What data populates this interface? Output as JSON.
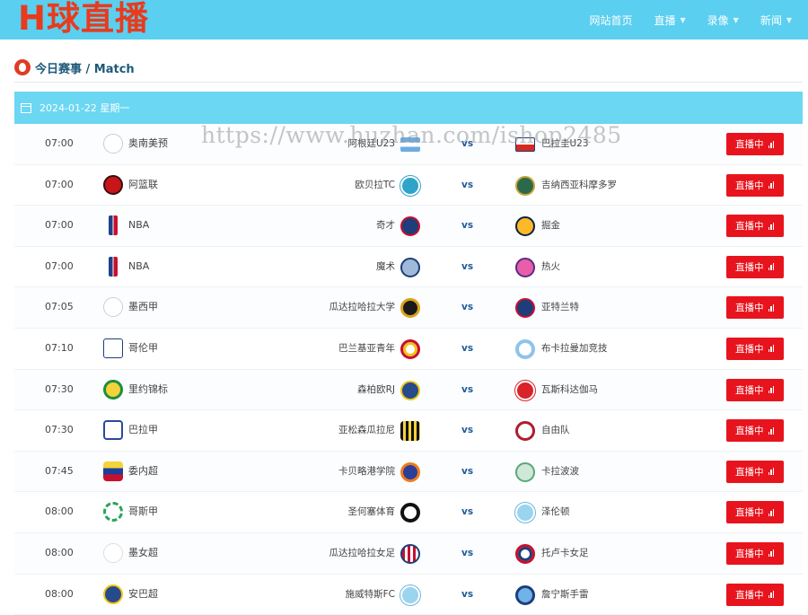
{
  "header": {
    "logo": "H球直播",
    "nav": [
      {
        "label": "网站首页",
        "has_caret": false
      },
      {
        "label": "直播",
        "has_caret": true
      },
      {
        "label": "录像",
        "has_caret": true
      },
      {
        "label": "新闻",
        "has_caret": true
      }
    ]
  },
  "section": {
    "title": "今日赛事 / Match"
  },
  "date_bar": {
    "date": "2024-01-22 星期一"
  },
  "watermark": "https://www.huzhan.com/ishop2485",
  "matches": [
    {
      "time": "07:00",
      "league": "奥南美预",
      "home": "阿根廷U23",
      "away": "巴拉圭U23",
      "vs": "vs",
      "status": "直播中"
    },
    {
      "time": "07:00",
      "league": "阿篮联",
      "home": "欧贝拉TC",
      "away": "吉纳西亚科摩多罗",
      "vs": "vs",
      "status": "直播中"
    },
    {
      "time": "07:00",
      "league": "NBA",
      "home": "奇才",
      "away": "掘金",
      "vs": "vs",
      "status": "直播中"
    },
    {
      "time": "07:00",
      "league": "NBA",
      "home": "魔术",
      "away": "热火",
      "vs": "vs",
      "status": "直播中"
    },
    {
      "time": "07:05",
      "league": "墨西甲",
      "home": "瓜达拉哈拉大学",
      "away": "亚特兰特",
      "vs": "vs",
      "status": "直播中"
    },
    {
      "time": "07:10",
      "league": "哥伦甲",
      "home": "巴兰基亚青年",
      "away": "布卡拉曼加竞技",
      "vs": "vs",
      "status": "直播中"
    },
    {
      "time": "07:30",
      "league": "里约锦标",
      "home": "森柏欧RJ",
      "away": "瓦斯科达伽马",
      "vs": "vs",
      "status": "直播中"
    },
    {
      "time": "07:30",
      "league": "巴拉甲",
      "home": "亚松森瓜拉尼",
      "away": "自由队",
      "vs": "vs",
      "status": "直播中"
    },
    {
      "time": "07:45",
      "league": "委内超",
      "home": "卡贝略港学院",
      "away": "卡拉波波",
      "vs": "vs",
      "status": "直播中"
    },
    {
      "time": "08:00",
      "league": "哥斯甲",
      "home": "圣何塞体育",
      "away": "泽伦顿",
      "vs": "vs",
      "status": "直播中"
    },
    {
      "time": "08:00",
      "league": "墨女超",
      "home": "瓜达拉哈拉女足",
      "away": "托卢卡女足",
      "vs": "vs",
      "status": "直播中"
    },
    {
      "time": "08:00",
      "league": "安巴超",
      "home": "施威特斯FC",
      "away": "詹宁斯手雷",
      "vs": "vs",
      "status": "直播中"
    }
  ],
  "icons": {
    "league": [
      "olympic-rings-icon",
      "argentina-basketball-league-icon",
      "nba-icon",
      "nba-icon",
      "liga-mx-icon",
      "liga-betplay-icon",
      "brazil-federation-icon",
      "paraguay-league-icon",
      "venezuela-league-icon",
      "costa-rica-league-icon",
      "liga-mx-femenil-icon",
      "antigua-league-icon"
    ],
    "home": [
      "argentina-flag-icon",
      "obera-tc-badge-icon",
      "wizards-badge-icon",
      "magic-badge-icon",
      "leones-negros-badge-icon",
      "junior-barranquilla-badge-icon",
      "sampaio-rj-badge-icon",
      "guarani-badge-icon",
      "academia-puerto-cabello-badge-icon",
      "saprissa-badge-icon",
      "chivas-femenil-badge-icon",
      "swetes-fc-badge-icon"
    ],
    "away": [
      "paraguay-flag-icon",
      "gimnasia-comodoro-badge-icon",
      "nuggets-badge-icon",
      "heat-badge-icon",
      "atlante-badge-icon",
      "bucaramanga-badge-icon",
      "vasco-badge-icon",
      "libertad-badge-icon",
      "carabobo-badge-icon",
      "zeledon-badge-icon",
      "toluca-femenil-badge-icon",
      "jennings-grenades-badge-icon"
    ]
  },
  "colors": {
    "topbar": "#5bcfef",
    "logo": "#e83b1e",
    "date_bar": "#6bd7f2",
    "live_button": "#e8141d",
    "vs": "#1e5a9a"
  }
}
